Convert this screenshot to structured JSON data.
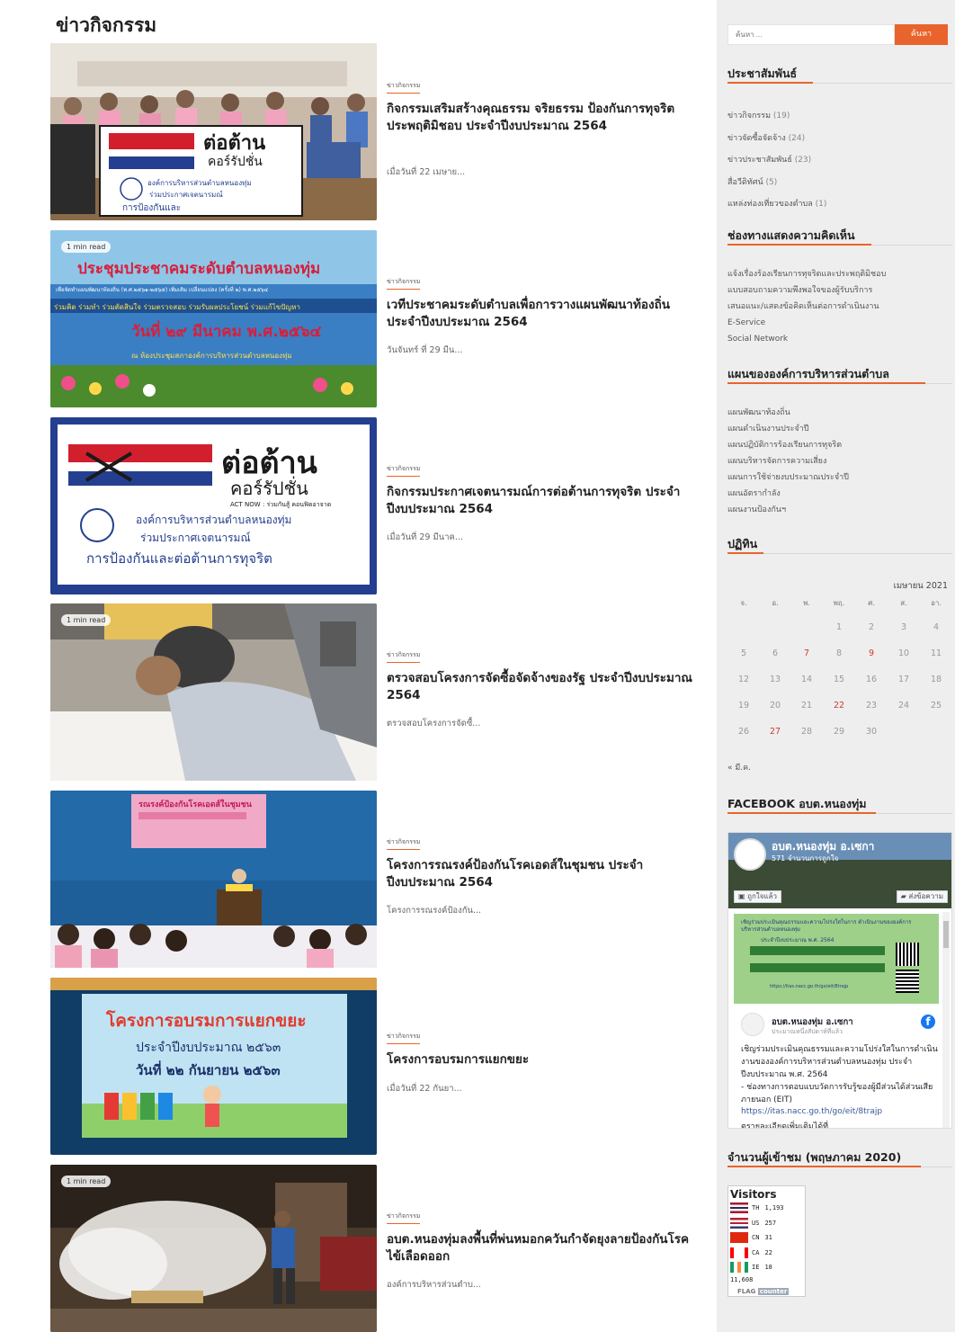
{
  "page_title": "ข่าวกิจกรรม",
  "posts": [
    {
      "category": "ข่าวกิจกรรม",
      "title": "กิจกรรมเสริมสร้างคุณธรรม จริยธรรม ป้องกันการทุจริตประพฤติมิชอบ ประจำปีงบประมาณ 2564",
      "excerpt": "เมื่อวันที่ 22 เมษาย...",
      "badge": ""
    },
    {
      "category": "ข่าวกิจกรรม",
      "title": "เวทีประชาคมระดับตำบลเพื่อการวางแผนพัฒนาท้องถิ่น ประจำปีงบประมาณ 2564",
      "excerpt": "วันจันทร์ ที่ 29 มีน...",
      "badge": "1 min read"
    },
    {
      "category": "ข่าวกิจกรรม",
      "title": "กิจกรรมประกาศเจตนารมณ์การต่อต้านการทุจริต ประจำปีงบประมาณ 2564",
      "excerpt": "เมื่อวันที่ 29 มีนาค...",
      "badge": ""
    },
    {
      "category": "ข่าวกิจกรรม",
      "title": "ตรวจสอบโครงการจัดซื้อจัดจ้างของรัฐ ประจำปีงบประมาณ 2564",
      "excerpt": "ตรวจสอบโครงการจัดซื้...",
      "badge": "1 min read"
    },
    {
      "category": "ข่าวกิจกรรม",
      "title": "โครงการรณรงค์ป้องกันโรคเอดส์ในชุมชน ประจำปีงบประมาณ 2564",
      "excerpt": "โครงการรณรงค์ป้องกัน...",
      "badge": ""
    },
    {
      "category": "ข่าวกิจกรรม",
      "title": "โครงการอบรมการแยกขยะ",
      "excerpt": "เมื่อวันที่ 22 กันยา...",
      "badge": ""
    },
    {
      "category": "ข่าวกิจกรรม",
      "title": "อบต.หนองทุ่มลงพื้นที่พ่นหมอกควันกำจัดยุงลายป้องกันโรคไข้เลือดออก",
      "excerpt": "องค์การบริหารส่วนตำบ...",
      "badge": "1 min read"
    }
  ],
  "images": {
    "banner1_line1": "ต่อต้าน",
    "banner1_line2": "คอร์รัปชั่น",
    "banner1_sub": "องค์การบริหารส่วนตำบลหนองทุ่ม",
    "banner1_sub2": "ร่วมประกาศเจตนารมณ์",
    "banner1_sub3": "การป้องกันและ",
    "banner2_line1": "ประชุมประชาคมระดับตำบลหนองทุ่ม",
    "banner2_line2": "เพื่อจัดทำแผนพัฒนาท้องถิ่น (พ.ศ.๒๕๖๑-๒๕๖๕) เพิ่มเติม เปลี่ยนแปลง (ครั้งที่ ๒) พ.ศ.๒๕๖๔",
    "banner2_line3": "ร่วมคิด ร่วมทำ ร่วมตัดสินใจ ร่วมตรวจสอบ ร่วมรับผลประโยชน์ ร่วมแก้ไขปัญหา",
    "banner2_line4": "วันที่ ๒๙ มีนาคม พ.ศ.๒๕๖๔",
    "banner2_line5": "ณ ห้องประชุมสภาองค์การบริหารส่วนตำบลหนองทุ่ม",
    "banner3_line1": "ต่อต้าน",
    "banner3_line2": "คอร์รัปชั่น",
    "banner3_act": "ACT NOW : ร่วมกันสู้ คอนฟิดอาจาด",
    "banner3_sub": "องค์การบริหารส่วนตำบลหนองทุ่ม",
    "banner3_sub2": "ร่วมประกาศเจตนารมณ์",
    "banner3_sub3": "การป้องกันและต่อต้านการทุจริต",
    "banner5_line1": "รณรงค์ป้องกันโรคเอดส์ในชุมชน",
    "banner6_line1": "โครงการอบรมการแยกขยะ",
    "banner6_line2": "ประจำปีงบประมาณ ๒๕๖๓",
    "banner6_line3": "วันที่ ๒๒ กันยายน ๒๕๖๓"
  },
  "sidebar": {
    "search_placeholder": "ค้นหา ...",
    "search_button": "ค้นหา",
    "pr_title": "ประชาสัมพันธ์",
    "pr_items": [
      {
        "label": "ข่าวกิจกรรม",
        "count": "(19)"
      },
      {
        "label": "ข่าวจัดซื้อจัดจ้าง",
        "count": "(24)"
      },
      {
        "label": "ข่าวประชาสัมพันธ์",
        "count": "(23)"
      },
      {
        "label": "สื่อวีดิทัศน์",
        "count": "(5)"
      },
      {
        "label": "แหล่งท่องเที่ยวของตำบล",
        "count": "(1)"
      }
    ],
    "channel_title": "ช่องทางแสดงความคิดเห็น",
    "channel_items": [
      "แจ้งเรื่องร้องเรียนการทุจริตและประพฤติมิชอบ",
      "แบบสอบถามความพึงพอใจของผู้รับบริการ",
      "เสนอแนะ/แสดงข้อคิดเห็นต่อการดำเนินงาน",
      "E-Service",
      "Social Network"
    ],
    "plan_title": "แผนขององค์การบริหารส่วนตำบล",
    "plan_items": [
      "แผนพัฒนาท้องถิ่น",
      "แผนดำเนินงานประจำปี",
      "แผนปฏิบัติการร้องเรียนการทุจริต",
      "แผนบริหารจัดการความเสี่ยง",
      "แผนการใช้จ่ายงบประมาณประจำปี",
      "แผนอัตรากำลัง",
      "แผนงานป้องกันฯ"
    ],
    "calendar_title": "ปฏิทิน",
    "calendar": {
      "caption": "เมษายน 2021",
      "weekdays": [
        "จ.",
        "อ.",
        "พ.",
        "พฤ.",
        "ศ.",
        "ส.",
        "อา."
      ],
      "weeks": [
        [
          "",
          "",
          "",
          "1",
          "2",
          "3",
          "4"
        ],
        [
          "5",
          "6",
          "7",
          "8",
          "9",
          "10",
          "11"
        ],
        [
          "12",
          "13",
          "14",
          "15",
          "16",
          "17",
          "18"
        ],
        [
          "19",
          "20",
          "21",
          "22",
          "23",
          "24",
          "25"
        ],
        [
          "26",
          "27",
          "28",
          "29",
          "30",
          "",
          ""
        ]
      ],
      "highlighted_days": [
        "7",
        "9",
        "22",
        "27"
      ],
      "prev_link": "« มี.ค."
    },
    "facebook_title": "FACEBOOK อบต.หนองทุ่ม",
    "facebook": {
      "page_name": "อบต.หนองทุ่ม อ.เซกา",
      "likes": "571 จำนวนการถูกใจ",
      "like_button": "ถูกใจแล้ว",
      "message_button": "ส่งข้อความ",
      "post_author": "อบต.หนองทุ่ม อ.เซกา",
      "post_time": "ประมาณหนึ่งสัปดาห์ที่แล้ว",
      "post_text": "เชิญร่วมประเมินคุณธรรมและความโปร่งใสในการดำเนินงานขององค์การบริหารส่วนตำบลหนองทุ่ม ประจำปีงบประมาณ พ.ศ. 2564\n- ช่องทางการตอบแบบวัดการรับรู้ของผู้มีส่วนได้ส่วนเสียภายนอก (EIT)",
      "post_link": "https://itas.nacc.go.th/go/eit/8trajp",
      "post_more": "ตรายละเอียดเพิ่มเติมได้ที่",
      "poster_title": "เชิญร่วมประเมินคุณธรรมและความโปร่งใสในการ ดำเนินงานขององค์การบริหารส่วนตำบลหนองทุ่ม",
      "poster_sub": "ประจำปีงบประมาณ พ.ศ. 2564",
      "poster_link": "https://itas.nacc.go.th/go/eit/8trajp"
    },
    "visitors_title": "จำนวนผู้เข้าชม (พฤษภาคม 2020)",
    "visitors": {
      "heading": "Visitors",
      "rows": [
        {
          "code": "TH",
          "count": "1,193"
        },
        {
          "code": "US",
          "count": "257"
        },
        {
          "code": "CN",
          "count": "31"
        },
        {
          "code": "CA",
          "count": "22"
        },
        {
          "code": "IE",
          "count": "18"
        }
      ],
      "total": "11,608",
      "footer_a": "FLAG",
      "footer_b": "counter"
    }
  },
  "colors": {
    "accent": "#e8642c",
    "sidebar_bg": "#eeeeee",
    "calendar_red": "#d03a2a"
  }
}
